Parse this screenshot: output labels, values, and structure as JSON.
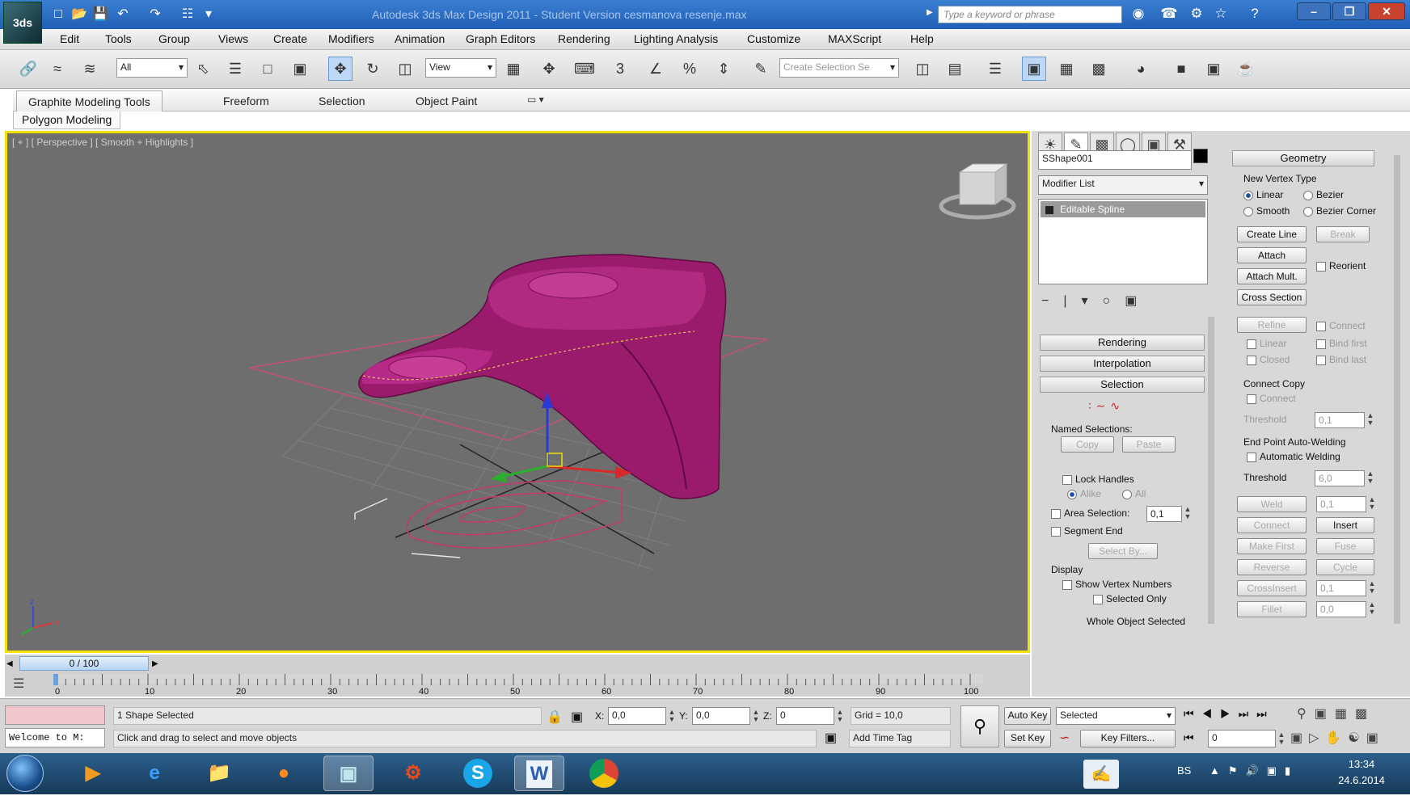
{
  "window": {
    "title": "Autodesk 3ds Max Design 2011 - Student Version   cesmanova resenje.max",
    "search_placeholder": "Type a keyword or phrase",
    "app_icon_label": "3ds"
  },
  "menu": [
    "Edit",
    "Tools",
    "Group",
    "Views",
    "Create",
    "Modifiers",
    "Animation",
    "Graph Editors",
    "Rendering",
    "Lighting Analysis",
    "Customize",
    "MAXScript",
    "Help"
  ],
  "toolbar": {
    "filter_value": "All",
    "ref_coord_value": "View",
    "named_selection_placeholder": "Create Selection Se",
    "snap_3": "3",
    "snap_percent": "%"
  },
  "ribbon": {
    "tabs": [
      "Graphite Modeling Tools",
      "Freeform",
      "Selection",
      "Object Paint"
    ],
    "sub_tab": "Polygon Modeling"
  },
  "viewport": {
    "label": "[ + ] [ Perspective ] [ Smooth + Highlights ]",
    "object_color": "#9a1a6c",
    "axis_z": "z",
    "axis_x": "x"
  },
  "panel": {
    "object_name": "SShape001",
    "modifier_list": "Modifier List",
    "stack_item": "Editable Spline",
    "rollouts": {
      "rendering": "Rendering",
      "interpolation": "Interpolation",
      "selection": "Selection",
      "geometry": "Geometry"
    },
    "selection": {
      "named_selections": "Named Selections:",
      "copy": "Copy",
      "paste": "Paste",
      "lock_handles": "Lock Handles",
      "alike": "Alike",
      "all": "All",
      "area_selection": "Area Selection:",
      "area_value": "0,1",
      "segment_end": "Segment End",
      "select_by": "Select By...",
      "display": "Display",
      "show_vertex_numbers": "Show Vertex Numbers",
      "selected_only": "Selected Only",
      "whole_object_selected": "Whole Object Selected"
    },
    "geometry": {
      "new_vertex_type": "New Vertex Type",
      "linear": "Linear",
      "bezier": "Bezier",
      "smooth": "Smooth",
      "bezier_corner": "Bezier Corner",
      "create_line": "Create Line",
      "break": "Break",
      "attach": "Attach",
      "reorient": "Reorient",
      "attach_mult": "Attach Mult.",
      "cross_section": "Cross Section",
      "refine": "Refine",
      "connect": "Connect",
      "linear_chk": "Linear",
      "bind_first": "Bind first",
      "closed": "Closed",
      "bind_last": "Bind last",
      "connect_copy": "Connect Copy",
      "connect_chk": "Connect",
      "threshold_label": "Threshold",
      "threshold_value": "0,1",
      "end_point_welding": "End Point Auto-Welding",
      "automatic_welding": "Automatic Welding",
      "threshold2_label": "Threshold",
      "threshold2_value": "6,0",
      "weld": "Weld",
      "weld_value": "0,1",
      "connect_btn": "Connect",
      "insert": "Insert",
      "make_first": "Make First",
      "fuse": "Fuse",
      "reverse": "Reverse",
      "cycle": "Cycle",
      "crossinsert": "CrossInsert",
      "crossinsert_value": "0,1",
      "fillet": "Fillet",
      "fillet_value": "0,0"
    }
  },
  "timeline": {
    "slider_label": "0 / 100",
    "ticks": [
      "0",
      "10",
      "20",
      "30",
      "40",
      "50",
      "60",
      "70",
      "80",
      "90",
      "100"
    ]
  },
  "status": {
    "maxscript_text": "Welcome to M:",
    "selection_info": "1 Shape Selected",
    "prompt": "Click and drag to select and move objects",
    "x_label": "X:",
    "x_value": "0,0",
    "y_label": "Y:",
    "y_value": "0,0",
    "z_label": "Z:",
    "z_value": "0",
    "grid": "Grid = 10,0",
    "add_time_tag": "Add Time Tag",
    "auto_key": "Auto Key",
    "set_key": "Set Key",
    "selected_dropdown": "Selected",
    "key_filters": "Key Filters...",
    "frame_value": "0"
  },
  "taskbar": {
    "language": "BS",
    "time": "13:34",
    "date": "24.6.2014"
  }
}
